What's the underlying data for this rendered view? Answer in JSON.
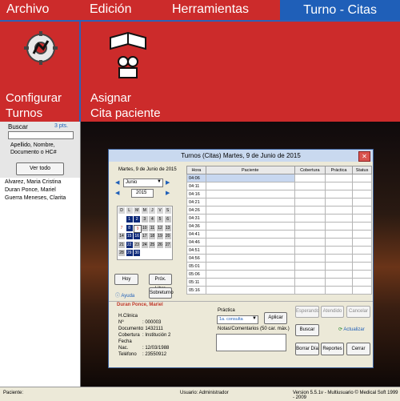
{
  "menu": {
    "archivo": "Archivo",
    "edicion": "Edición",
    "herramientas": "Herramientas",
    "turno_citas": "Turno - Citas"
  },
  "ribbon": {
    "configurar_line1": "Configurar",
    "configurar_line2": "Turnos",
    "asignar_line1": "Asignar",
    "asignar_line2": "Cita paciente"
  },
  "sidebar": {
    "buscar_label": "Buscar",
    "pts": "3 pts.",
    "hint_line1": "Apellido, Nombre,",
    "hint_line2": "Documento o HC#",
    "ver_todo": "Ver todo",
    "patients": [
      "Alvarez, Maria Cristina",
      "Duran Ponce, Mariel",
      "Guerra Meneses, Clarita"
    ]
  },
  "window": {
    "title": "Turnos (Citas)  Martes, 9 de Junio de 2015",
    "date_label": "Martes, 9 de Junio de 2015",
    "month": "Junio",
    "year": "2015",
    "weekdays": [
      "D",
      "L",
      "M",
      "M",
      "J",
      "V",
      "S"
    ],
    "calendar": [
      [
        "",
        "1",
        "2",
        "3",
        "4",
        "5",
        "6"
      ],
      [
        "7",
        "8",
        "9",
        "10",
        "11",
        "12",
        "13"
      ],
      [
        "14",
        "15",
        "16",
        "17",
        "18",
        "19",
        "20"
      ],
      [
        "21",
        "22",
        "23",
        "24",
        "25",
        "26",
        "27"
      ],
      [
        "28",
        "29",
        "30",
        "",
        "",
        "",
        ""
      ]
    ],
    "hoy": "Hoy",
    "prox_libre": "Próx. Libre",
    "ayuda": "Ayuda",
    "sobreturno": "Sobreturno",
    "table_headers": [
      "Hora",
      "Paciente",
      "Cobertura",
      "Práctica",
      "Status"
    ],
    "times": [
      "04:06",
      "04:11",
      "04:16",
      "04:21",
      "04:26",
      "04:31",
      "04:36",
      "04:41",
      "04:46",
      "04:51",
      "04:56",
      "05:01",
      "05:06",
      "05:11",
      "05:16"
    ],
    "patient_name": "Duran Ponce, Mariel",
    "fields": [
      {
        "label": "H.Clinica Nº",
        "value": ": 000003"
      },
      {
        "label": "Documento",
        "value": ": 1432111"
      },
      {
        "label": "Cobertura",
        "value": ": Institución 2"
      },
      {
        "label": "Fecha Nac.",
        "value": ": 12/03/1988"
      },
      {
        "label": "Teléfono",
        "value": ": 23550912"
      }
    ],
    "practica_label": "Práctica",
    "practica_value": "1a. consulta",
    "aplicar": "Aplicar",
    "notas_label": "Notas/Comentarios (50 car. máx.)",
    "esperando": "Esperando",
    "atendido": "Atendido",
    "cancelar": "Cancelar",
    "buscar": "Buscar",
    "actualizar": "Actualizar",
    "borrar_dia": "Borrar Día",
    "reportes": "Reportes",
    "cerrar": "Cerrar"
  },
  "status": {
    "paciente": "Paciente:",
    "usuario": "Usuario: Administrador",
    "version": "Version 5.5.1v - Multiusuario  © Medical Soft 1999 - 2009"
  },
  "colors": {
    "menu_red": "#cc2b2b",
    "blue": "#1f5fb8",
    "cal_blue": "#0e2a7a"
  }
}
